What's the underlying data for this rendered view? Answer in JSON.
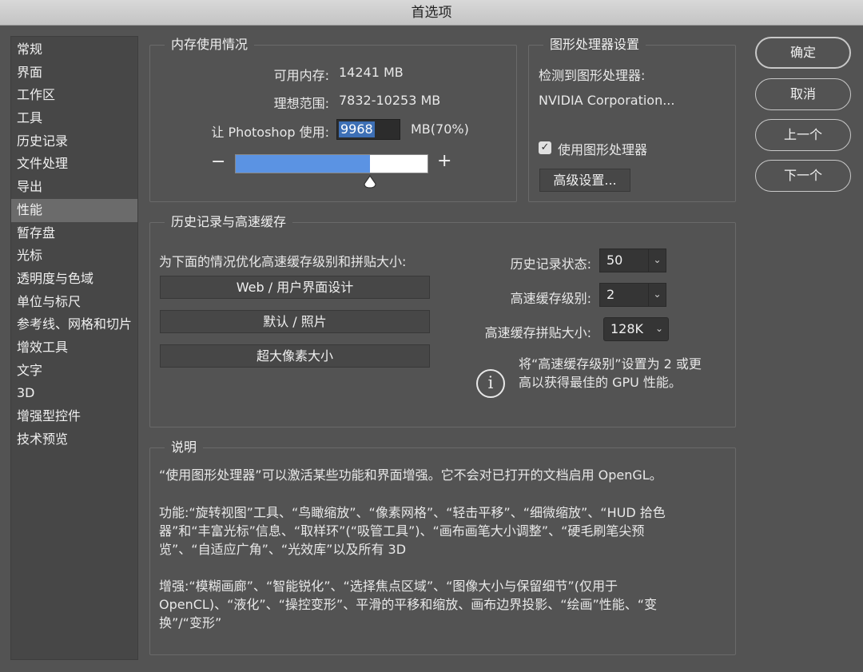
{
  "window": {
    "title": "首选项"
  },
  "sidebar": {
    "items": [
      {
        "label": "常规"
      },
      {
        "label": "界面"
      },
      {
        "label": "工作区"
      },
      {
        "label": "工具"
      },
      {
        "label": "历史记录"
      },
      {
        "label": "文件处理"
      },
      {
        "label": "导出"
      },
      {
        "label": "性能"
      },
      {
        "label": "暂存盘"
      },
      {
        "label": "光标"
      },
      {
        "label": "透明度与色域"
      },
      {
        "label": "单位与标尺"
      },
      {
        "label": "参考线、网格和切片"
      },
      {
        "label": "增效工具"
      },
      {
        "label": "文字"
      },
      {
        "label": "3D"
      },
      {
        "label": "增强型控件"
      },
      {
        "label": "技术预览"
      }
    ],
    "selected": "性能"
  },
  "memory": {
    "title": "内存使用情况",
    "available_label": "可用内存:",
    "available_value": "14241 MB",
    "ideal_label": "理想范围:",
    "ideal_value": "7832-10253 MB",
    "use_label": "让 Photoshop 使用:",
    "use_value": "9968",
    "use_unit": "MB(70%)",
    "percent": 0.7,
    "minus": "−",
    "plus": "+"
  },
  "gpu": {
    "title": "图形处理器设置",
    "detected_label": "检测到图形处理器:",
    "detected_value": "NVIDIA Corporation...",
    "use_gpu_label": "使用图形处理器",
    "use_gpu_checked": true,
    "advanced_button": "高级设置..."
  },
  "actions": {
    "ok": "确定",
    "cancel": "取消",
    "prev": "上一个",
    "next": "下一个"
  },
  "cache": {
    "title": "历史记录与高速缓存",
    "optimize_label": "为下面的情况优化高速缓存级别和拼贴大小:",
    "preset_web": "Web / 用户界面设计",
    "preset_default": "默认 / 照片",
    "preset_huge": "超大像素大小",
    "history_states_label": "历史记录状态:",
    "history_states_value": "50",
    "cache_levels_label": "高速缓存级别:",
    "cache_levels_value": "2",
    "tile_size_label": "高速缓存拼贴大小:",
    "tile_size_value": "128K",
    "tip_line1": "将“高速缓存级别”设置为 2 或更",
    "tip_line2": "高以获得最佳的 GPU 性能。"
  },
  "description": {
    "title": "说明",
    "p1": "“使用图形处理器”可以激活某些功能和界面增强。它不会对已打开的文档启用 OpenGL。",
    "p2_l1": "功能:“旋转视图”工具、“鸟瞰缩放”、“像素网格”、“轻击平移”、“细微缩放”、“HUD 拾色",
    "p2_l2": "器”和“丰富光标”信息、“取样环”(“吸管工具”)、“画布画笔大小调整”、“硬毛刷笔尖预",
    "p2_l3": "览”、“自适应广角”、“光效库”以及所有 3D",
    "p3_l1": "增强:“模糊画廊”、“智能锐化”、“选择焦点区域”、“图像大小与保留细节”(仅用于",
    "p3_l2": "OpenCL)、“液化”、“操控变形”、平滑的平移和缩放、画布边界投影、“绘画”性能、“变",
    "p3_l3": "换”/“变形”"
  },
  "colors": {
    "background": "#535353",
    "slider_fill": "#5b93e3",
    "selection": "#3d6fb5"
  }
}
